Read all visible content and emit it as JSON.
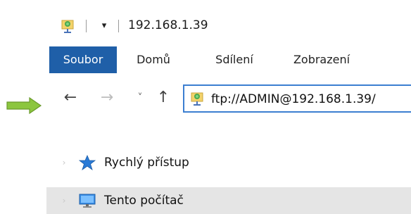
{
  "window": {
    "title": "192.168.1.39",
    "quick_access_dropdown": "▾"
  },
  "ribbon": {
    "tabs": [
      {
        "label": "Soubor",
        "active": true
      },
      {
        "label": "Domů",
        "active": false
      },
      {
        "label": "Sdílení",
        "active": false
      },
      {
        "label": "Zobrazení",
        "active": false
      }
    ]
  },
  "nav": {
    "back": "←",
    "forward": "→",
    "recent": "˅",
    "up": "↑",
    "address": "ftp://ADMIN@192.168.1.39/"
  },
  "sidebar": {
    "items": [
      {
        "label": "Rychlý přístup",
        "icon": "star-icon"
      },
      {
        "label": "Tento počítač",
        "icon": "computer-icon",
        "selected": true
      }
    ],
    "chevron": "›"
  },
  "colors": {
    "accent": "#1f5fa8",
    "address_border": "#3c7fd1",
    "selection": "#e5e5e5",
    "annotation_arrow": "#7dbb3c"
  }
}
